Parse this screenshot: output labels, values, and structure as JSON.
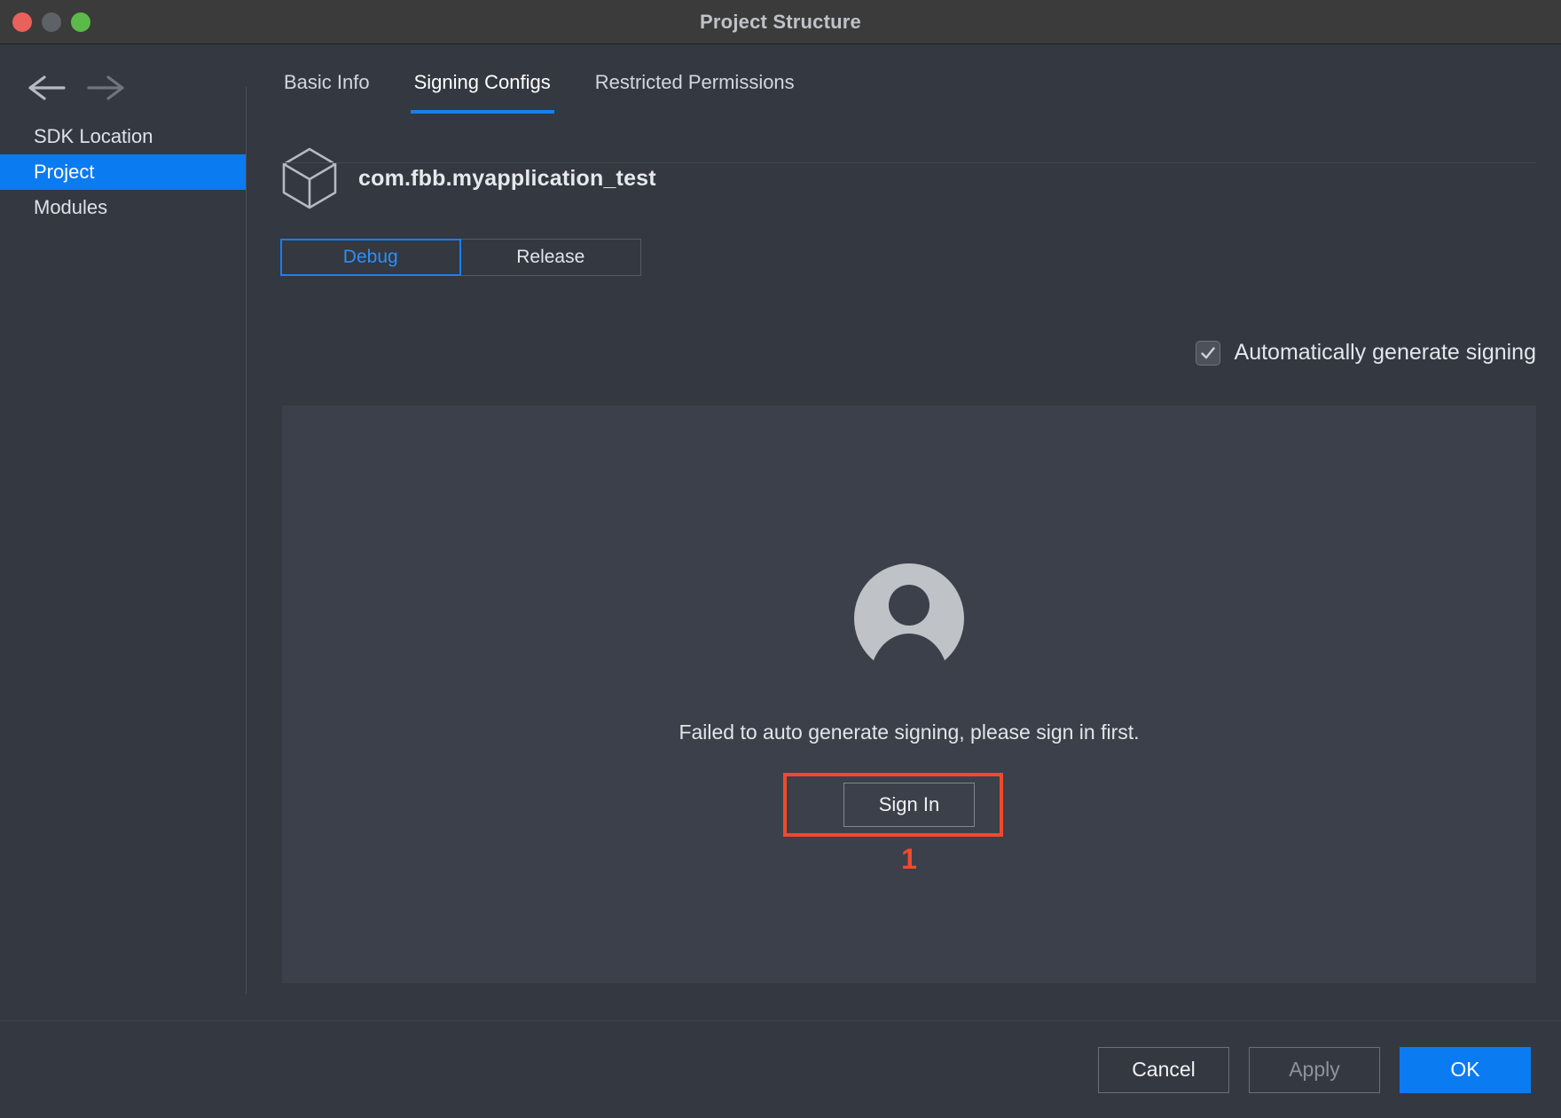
{
  "window": {
    "title": "Project Structure",
    "traffic_lights": [
      "close-button",
      "minimize-button",
      "zoom-button"
    ]
  },
  "sidebar": {
    "back_icon": "arrow-left-icon",
    "forward_icon": "arrow-right-icon",
    "items": [
      {
        "label": "SDK Location",
        "selected": false
      },
      {
        "label": "Project",
        "selected": true
      },
      {
        "label": "Modules",
        "selected": false
      }
    ]
  },
  "main": {
    "tabs": [
      {
        "label": "Basic Info",
        "active": false
      },
      {
        "label": "Signing Configs",
        "active": true
      },
      {
        "label": "Restricted Permissions",
        "active": false
      }
    ],
    "app": {
      "icon": "cube-icon",
      "name": "com.fbb.myapplication_test"
    },
    "build_variants": [
      {
        "label": "Debug",
        "selected": true
      },
      {
        "label": "Release",
        "selected": false
      }
    ],
    "auto_generate": {
      "label": "Automatically generate signing",
      "checked": true,
      "checkbox_icon": "checkmark-icon"
    },
    "panel": {
      "avatar_icon": "user-avatar-icon",
      "message": "Failed to auto generate signing, please sign in first.",
      "sign_in_label": "Sign In",
      "annotation_number": "1"
    }
  },
  "footer": {
    "cancel_label": "Cancel",
    "apply_label": "Apply",
    "ok_label": "OK"
  },
  "colors": {
    "accent": "#0b7bf2",
    "tab_active": "#1a7ef0",
    "annotation": "#f04a2a",
    "dialog_bg": "#333841",
    "panel_bg": "#3c404a"
  }
}
